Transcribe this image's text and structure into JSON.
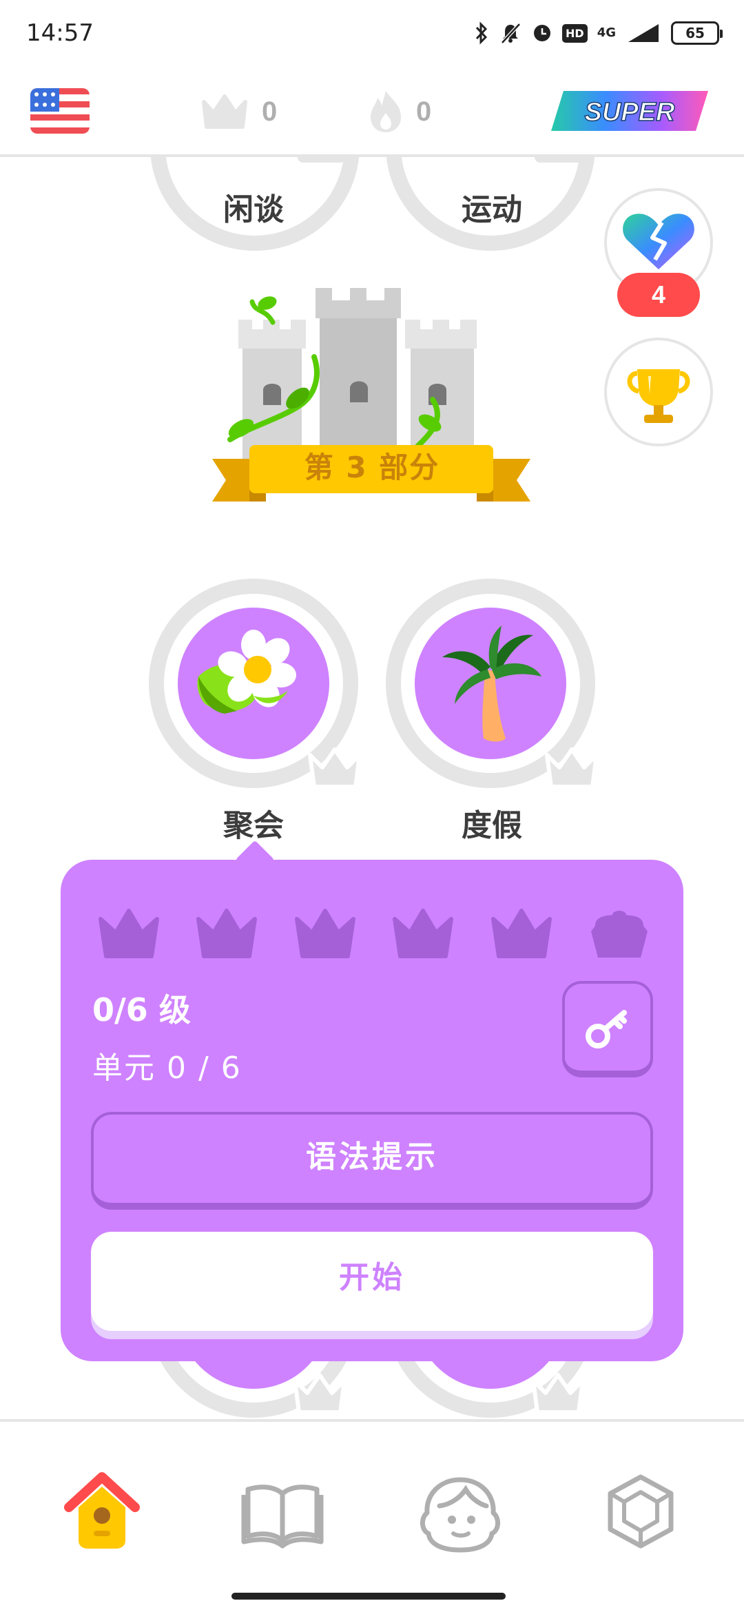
{
  "status_bar": {
    "time": "14:57",
    "hd_label": "HD",
    "network_label": "4G",
    "battery": "65"
  },
  "top_bar": {
    "crowns_count": "0",
    "streak_count": "0",
    "super_label": "SUPER"
  },
  "path": {
    "skills_row1": [
      "闲谈",
      "运动"
    ],
    "section_label": "第 3 部分",
    "skills_row2": [
      "聚会",
      "度假"
    ],
    "hearts_count": "4"
  },
  "popup": {
    "level_text": "0/6 级",
    "unit_text": "单元 0 / 6",
    "grammar_button": "语法提示",
    "start_button": "开始"
  },
  "colors": {
    "accent_purple": "#ce82ff",
    "popup_border": "#a560d8",
    "locked_gray": "#e5e5e5",
    "gold": "#ffc800",
    "heart_red": "#ff4b4b"
  },
  "icons": [
    "us-flag-icon",
    "crown-icon",
    "streak-flame-icon",
    "super-badge-icon",
    "broken-heart-icon",
    "trophy-icon",
    "castle-icon",
    "flower-icon",
    "palm-tree-icon",
    "key-icon",
    "home-icon",
    "book-icon",
    "profile-icon",
    "shop-gem-icon"
  ]
}
